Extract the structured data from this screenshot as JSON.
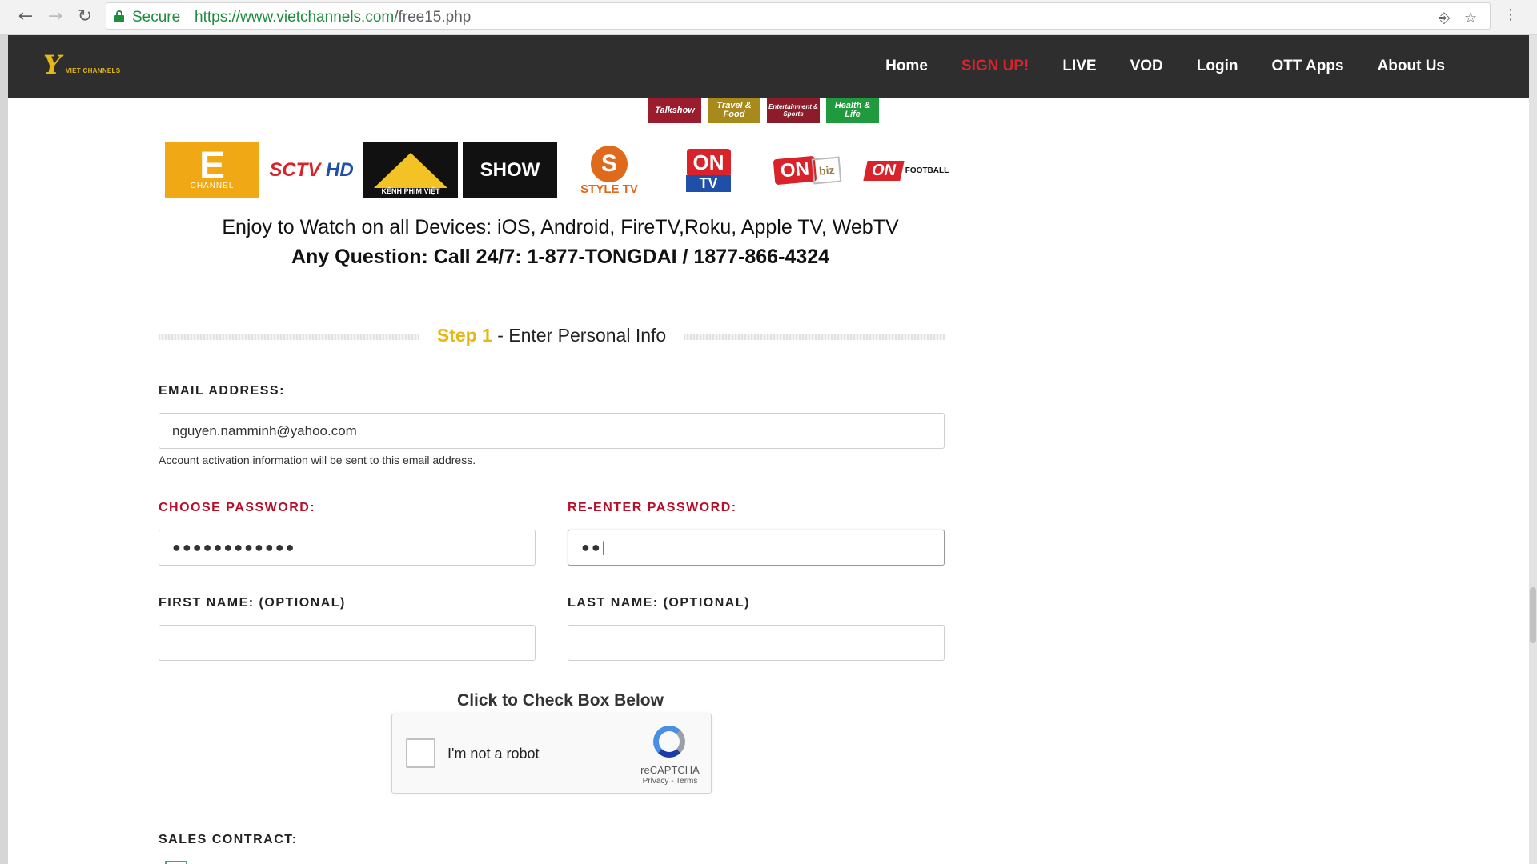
{
  "browser": {
    "secure_label": "Secure",
    "url_host": "https://www.vietchannels.com",
    "url_path": "/free15.php",
    "back_icon": "←",
    "forward_icon": "→",
    "reload_icon": "↻",
    "key_icon": "⎆",
    "star_icon": "☆",
    "menu_icon": "⋮"
  },
  "site": {
    "logo_mark": "Y",
    "logo_text": "VIET CHANNELS",
    "nav": [
      "Home",
      "SIGN UP!",
      "LIVE",
      "VOD",
      "Login",
      "OTT Apps",
      "About Us"
    ],
    "accent": "#e5b816",
    "signup_color": "#d8232a"
  },
  "thumbnails": [
    "Talkshow",
    "Travel & Food",
    "Entertainment & Sports",
    "Health & Life"
  ],
  "channel_logos": {
    "e_channel": {
      "mark": "E",
      "sub": "CHANNEL"
    },
    "sctv": {
      "a": "SCTV",
      "b": "HD"
    },
    "kenh_phim_viet": "KÊNH PHIM VIỆT",
    "show": "SHOW",
    "style_tv": {
      "mark": "S",
      "name": "STYLE TV"
    },
    "on_tv": {
      "on": "ON",
      "tv": "TV"
    },
    "on_biz": {
      "on": "ON",
      "biz": "biz"
    },
    "on_football": {
      "on": "ON",
      "name": "FOOTBALL"
    }
  },
  "tagline": {
    "line1": "Enjoy to Watch on all Devices: iOS, Android, FireTV,Roku, Apple TV, WebTV",
    "line2": "Any Question: Call 24/7:  1-877-TONGDAI / 1877-866-4324"
  },
  "step": {
    "num": "Step 1",
    "rest": " - Enter Personal Info"
  },
  "form": {
    "email_label": "EMAIL ADDRESS:",
    "email_value": "nguyen.namminh@yahoo.com",
    "email_hint": "Account activation information will be sent to this email address.",
    "password_label": "CHOOSE PASSWORD:",
    "password_value": "●●●●●●●●●●●●",
    "repassword_label": "RE-ENTER PASSWORD:",
    "repassword_value": "●●|",
    "firstname_label": "FIRST NAME: (OPTIONAL)",
    "firstname_value": "",
    "lastname_label": "LAST NAME: (OPTIONAL)",
    "lastname_value": "",
    "captcha_title": "Click to Check Box Below",
    "captcha_text": "I'm not a robot",
    "captcha_brand": "reCAPTCHA",
    "captcha_links": "Privacy - Terms",
    "sales_label": "SALES CONTRACT:"
  }
}
